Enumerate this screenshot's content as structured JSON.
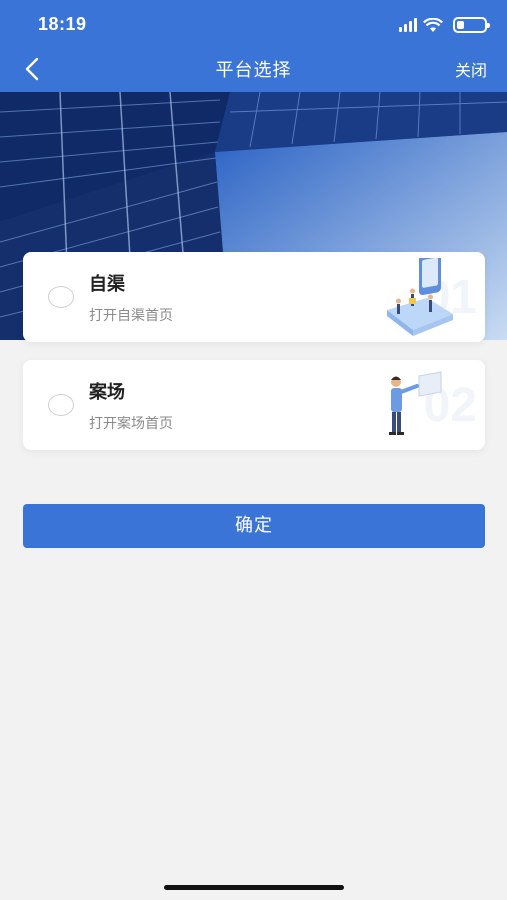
{
  "status_bar": {
    "time": "18:19"
  },
  "nav": {
    "title": "平台选择",
    "close_label": "关闭"
  },
  "options": [
    {
      "title": "自渠",
      "subtitle": "打开自渠首页",
      "number": "01",
      "selected": false
    },
    {
      "title": "案场",
      "subtitle": "打开案场首页",
      "number": "02",
      "selected": false
    }
  ],
  "confirm_label": "确定",
  "colors": {
    "primary": "#3a74d6",
    "background": "#f2f2f2"
  },
  "icons": [
    "chevron-left-icon",
    "signal-icon",
    "wifi-icon",
    "battery-icon",
    "phone-people-illustration",
    "presenter-illustration"
  ]
}
